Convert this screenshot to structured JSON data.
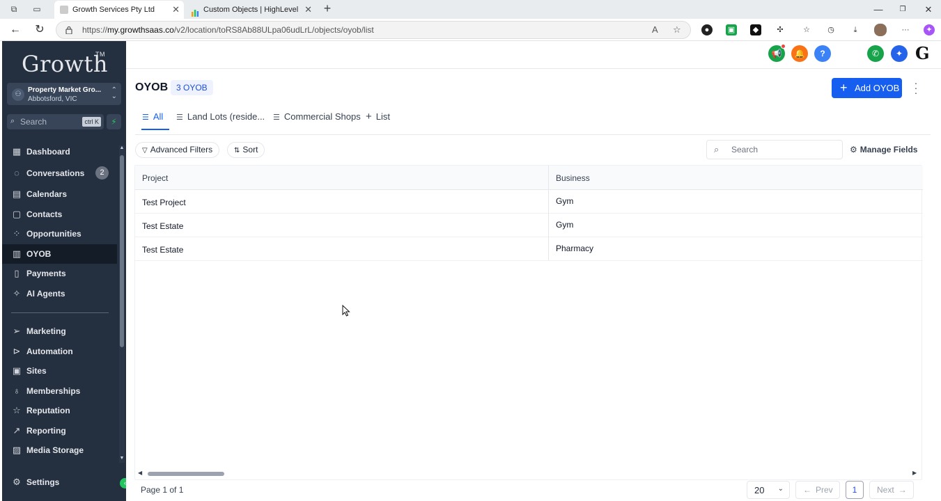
{
  "browser": {
    "tabs": [
      {
        "title": "Growth Services Pty Ltd",
        "active": true
      },
      {
        "title": "Custom Objects | HighLevel",
        "active": false
      }
    ],
    "url_prefix": "https://",
    "url_domain": "my.growthsaas.co",
    "url_path": "/v2/location/toRS8Ab88ULpa06udLrL/objects/oyob/list"
  },
  "sidebar": {
    "logo": "Growth",
    "logo_tm": "TM",
    "account": {
      "name": "Property Market Gro...",
      "location": "Abbotsford, VIC"
    },
    "search_placeholder": "Search",
    "search_shortcut": "ctrl K",
    "items": [
      {
        "label": "Dashboard",
        "icon": "dashboard-icon"
      },
      {
        "label": "Conversations",
        "icon": "chat-icon",
        "badge": "2"
      },
      {
        "label": "Calendars",
        "icon": "calendar-icon"
      },
      {
        "label": "Contacts",
        "icon": "contacts-icon"
      },
      {
        "label": "Opportunities",
        "icon": "opportunities-icon"
      },
      {
        "label": "OYOB",
        "icon": "building-icon",
        "active": true
      },
      {
        "label": "Payments",
        "icon": "payments-icon"
      },
      {
        "label": "AI Agents",
        "icon": "sparkle-icon"
      },
      {
        "label": "Marketing",
        "icon": "send-icon"
      },
      {
        "label": "Automation",
        "icon": "automation-icon"
      },
      {
        "label": "Sites",
        "icon": "sites-icon"
      },
      {
        "label": "Memberships",
        "icon": "membership-icon"
      },
      {
        "label": "Reputation",
        "icon": "star-icon"
      },
      {
        "label": "Reporting",
        "icon": "trend-icon"
      },
      {
        "label": "Media Storage",
        "icon": "image-icon"
      },
      {
        "label": "Settings",
        "icon": "gear-icon"
      }
    ]
  },
  "header": {
    "brand_mark": "G"
  },
  "page": {
    "title": "OYOB",
    "count_badge": "3 OYOB",
    "add_button": "Add OYOB",
    "view_tabs": [
      {
        "label": "All",
        "active": true
      },
      {
        "label": "Land Lots (reside..."
      },
      {
        "label": "Commercial Shops"
      },
      {
        "label": "List"
      }
    ],
    "filters_label": "Advanced Filters",
    "sort_label": "Sort",
    "search_placeholder": "Search",
    "manage_fields_label": "Manage Fields"
  },
  "table": {
    "columns": [
      "Project",
      "Business"
    ],
    "rows": [
      {
        "project": "Test Project",
        "business": "Gym"
      },
      {
        "project": "Test Estate",
        "business": "Gym"
      },
      {
        "project": "Test Estate",
        "business": "Pharmacy"
      }
    ]
  },
  "pagination": {
    "page_info": "Page 1 of 1",
    "per_page": "20",
    "prev_label": "Prev",
    "next_label": "Next",
    "current_page": "1"
  },
  "colors": {
    "sidebar_bg": "#243040",
    "primary": "#155eef",
    "success": "#22c55e",
    "warning": "#f97316"
  }
}
